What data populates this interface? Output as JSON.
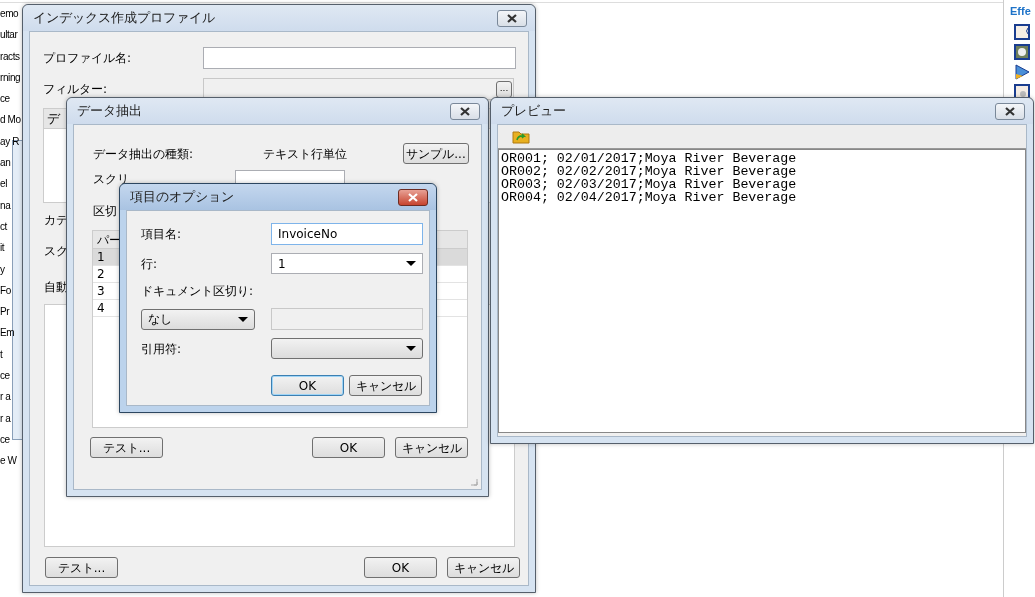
{
  "background_list": {
    "items": [
      "emo",
      "ultar",
      "racts",
      "rning",
      "ce",
      "d Mo",
      "ay R",
      "an",
      "el",
      "na",
      "ct",
      "it",
      "y",
      "Fo",
      "Pr",
      "Em",
      "t",
      "ce",
      "r a",
      "r a",
      "ce",
      "e W"
    ]
  },
  "side_panel": {
    "title": "Effe"
  },
  "profile_window": {
    "title": "インデックス作成プロファイル",
    "name_label": "プロファイル名:",
    "filter_label": "フィルター:",
    "browse_button": "...",
    "group_header": "デ",
    "clipped_labels": [
      "カテ",
      "スク",
      "自動"
    ],
    "buttons": [
      {
        "label": "テスト..."
      },
      {
        "label": "OK"
      },
      {
        "label": "キャンセル"
      }
    ]
  },
  "extract_window": {
    "title": "データ抽出",
    "type_label": "データ抽出の種類:",
    "type_value": "テキスト行単位",
    "sample_button": "サンプル...",
    "clipped_labels": [
      "スクリ",
      "区切"
    ],
    "table": {
      "column": "パー",
      "rows": [
        {
          "cell": "1",
          "selected": true
        },
        {
          "cell": "2",
          "selected": false
        },
        {
          "cell": "3",
          "selected": false
        },
        {
          "cell": "4",
          "selected": false
        }
      ]
    },
    "buttons": [
      {
        "label": "テスト..."
      },
      {
        "label": "OK"
      },
      {
        "label": "キャンセル"
      }
    ]
  },
  "options_dialog": {
    "title": "項目のオプション",
    "fields": [
      {
        "kind": "text",
        "label": "項目名:",
        "value": "InvoiceNo"
      },
      {
        "kind": "select",
        "label": "行:",
        "value": "1"
      },
      {
        "kind": "split",
        "label": "ドキュメント区切り:",
        "value": "なし",
        "disabled": true
      },
      {
        "kind": "select",
        "label": "引用符:"
      }
    ],
    "buttons": [
      {
        "label": "OK",
        "default": true
      },
      {
        "label": "キャンセル",
        "default": false
      }
    ]
  },
  "preview_window": {
    "title": "プレビュー",
    "lines": [
      "OR001; 02/01/2017;Moya River Beverage",
      "OR002; 02/02/2017;Moya River Beverage",
      "OR003; 02/03/2017;Moya River Beverage",
      "OR004; 02/04/2017;Moya River Beverage"
    ]
  }
}
